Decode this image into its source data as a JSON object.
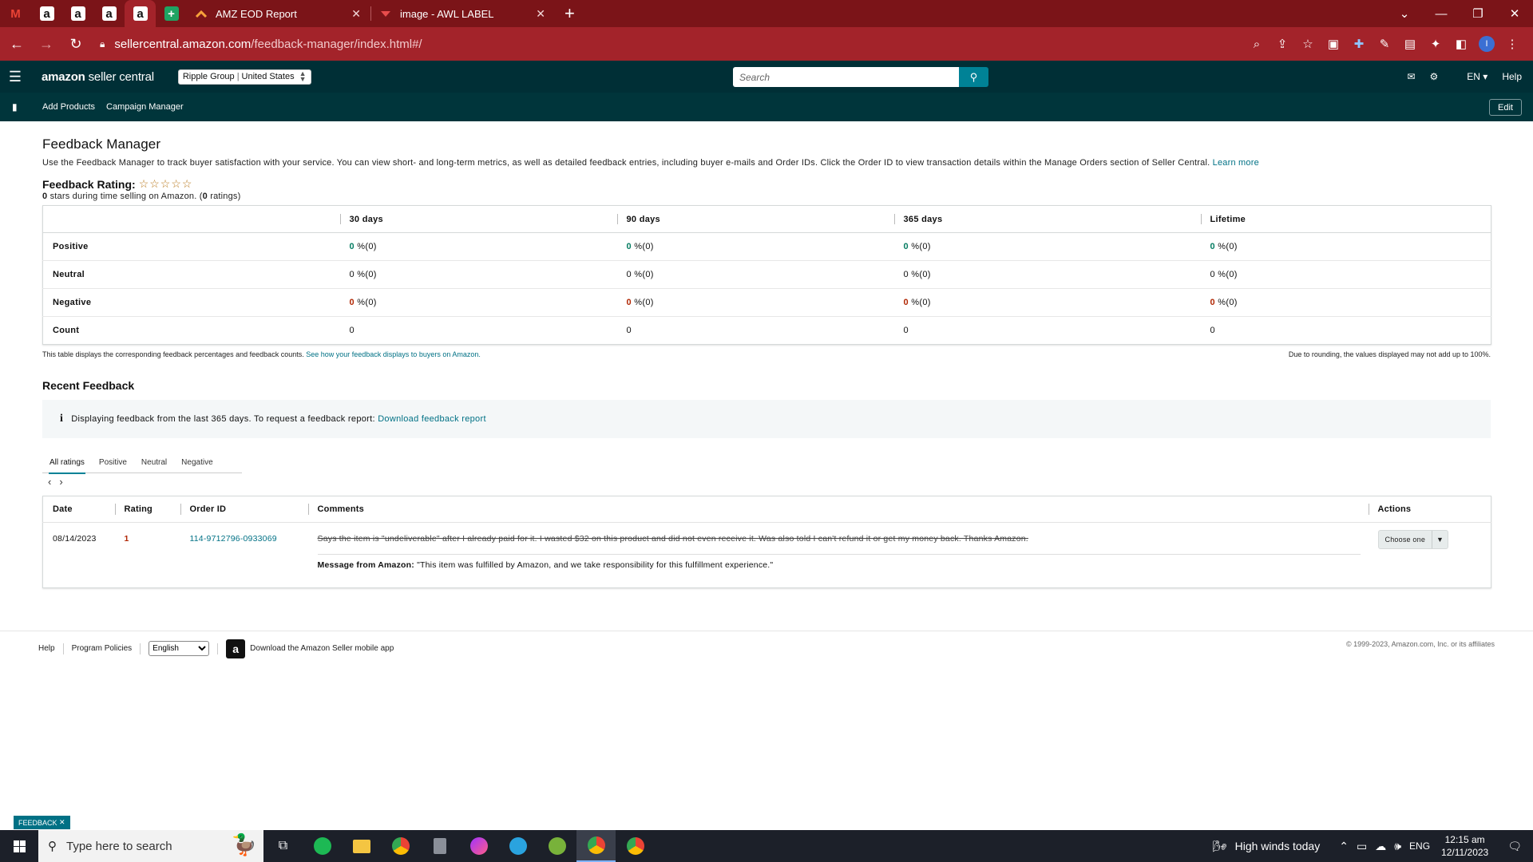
{
  "browser": {
    "tabs": [
      {
        "label": "AMZ EOD Report"
      },
      {
        "label": "image - AWL LABEL"
      }
    ],
    "url_host": "sellercentral.amazon.com",
    "url_path": "/feedback-manager/index.html#/"
  },
  "header": {
    "logo_main": "amazon",
    "logo_sub": "seller central",
    "account": "Ripple Group",
    "marketplace": "United States",
    "search_placeholder": "Search",
    "lang": "EN",
    "help": "Help"
  },
  "nav": {
    "items": [
      "Add Products",
      "Campaign Manager"
    ],
    "edit": "Edit"
  },
  "page": {
    "title": "Feedback Manager",
    "description": "Use the Feedback Manager to track buyer satisfaction with your service. You can view short- and long-term metrics, as well as detailed feedback entries, including buyer e-mails and Order IDs. Click the Order ID to view transaction details within the Manage Orders section of Seller Central.",
    "learn_more": "Learn more",
    "rating_label": "Feedback Rating:",
    "stars_count": "0",
    "stars_text": "stars during time selling on Amazon. (",
    "ratings_count": "0",
    "ratings_text": "ratings)"
  },
  "metrics": {
    "columns": [
      "30 days",
      "90 days",
      "365 days",
      "Lifetime"
    ],
    "rows": [
      {
        "label": "Positive",
        "cells": [
          "0",
          "0",
          "0",
          "0"
        ],
        "suffix": "%(0)"
      },
      {
        "label": "Neutral",
        "cells": [
          "0",
          "0",
          "0",
          "0"
        ],
        "suffix": "%(0)"
      },
      {
        "label": "Negative",
        "cells": [
          "0",
          "0",
          "0",
          "0"
        ],
        "suffix": "%(0)"
      }
    ],
    "count_label": "Count",
    "counts": [
      "0",
      "0",
      "0",
      "0"
    ],
    "note_left": "This table displays the corresponding feedback percentages and feedback counts.",
    "note_link": "See how your feedback displays to buyers on Amazon.",
    "note_right": "Due to rounding, the values displayed may not add up to 100%."
  },
  "recent": {
    "title": "Recent Feedback",
    "info": "Displaying feedback from the last 365 days. To request a feedback report:",
    "info_link": "Download feedback report",
    "tabs": [
      "All ratings",
      "Positive",
      "Neutral",
      "Negative"
    ],
    "columns": {
      "date": "Date",
      "rating": "Rating",
      "order": "Order ID",
      "comments": "Comments",
      "actions": "Actions"
    },
    "entry": {
      "date": "08/14/2023",
      "rating": "1",
      "order_id": "114-9712796-0933069",
      "comment": "Says the item is \"undeliverable\" after I already paid for it. I wasted $32 on this product and did not even receive it. Was also told I can't refund it or get my money back. Thanks Amazon.",
      "message_label": "Message from Amazon:",
      "message": "\"This item was fulfilled by Amazon, and we take responsibility for this fulfillment experience.\"",
      "action": "Choose one"
    }
  },
  "footer": {
    "help": "Help",
    "policies": "Program Policies",
    "language": "English",
    "app": "Download the Amazon Seller mobile app",
    "copyright": "© 1999-2023, Amazon.com, Inc. or its affiliates"
  },
  "feedback_tab": "FEEDBACK",
  "taskbar": {
    "search_placeholder": "Type here to search",
    "weather": "High winds today",
    "lang": "ENG",
    "time": "12:15 am",
    "date": "12/11/2023"
  },
  "colors": {
    "tabbar": "#7b1418",
    "addrbar": "#a3232a",
    "sc_header": "#002f36",
    "accent": "#008296",
    "positive": "#067d62",
    "negative": "#b12704"
  }
}
